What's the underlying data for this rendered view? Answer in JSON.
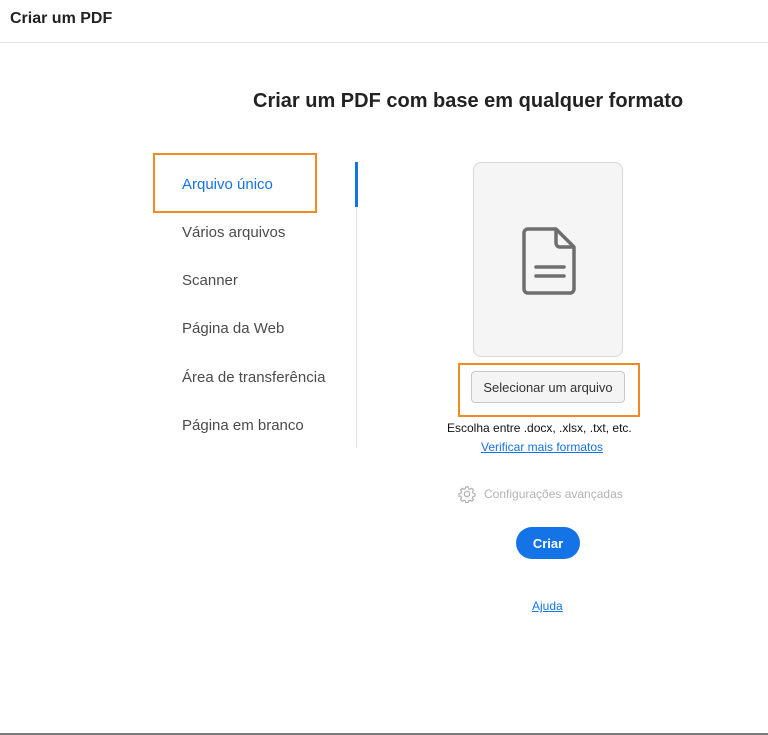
{
  "window": {
    "title": "Criar um PDF"
  },
  "main": {
    "heading": "Criar um PDF com base em qualquer formato"
  },
  "nav": {
    "items": [
      {
        "label": "Arquivo único",
        "active": true
      },
      {
        "label": "Vários arquivos",
        "active": false
      },
      {
        "label": "Scanner",
        "active": false
      },
      {
        "label": "Página da Web",
        "active": false
      },
      {
        "label": "Área de transferência",
        "active": false
      },
      {
        "label": "Página em branco",
        "active": false
      }
    ]
  },
  "file_panel": {
    "icon": "document-icon",
    "select_button": "Selecionar um arquivo",
    "formats_text": "Escolha entre .docx, .xlsx, .txt, etc.",
    "more_formats_link": "Verificar mais formatos"
  },
  "advanced": {
    "icon": "gear-icon",
    "label": "Configurações avançadas"
  },
  "actions": {
    "create_button": "Criar",
    "help_link": "Ajuda"
  },
  "colors": {
    "accent": "#1473e6",
    "highlight": "#f08a24"
  }
}
